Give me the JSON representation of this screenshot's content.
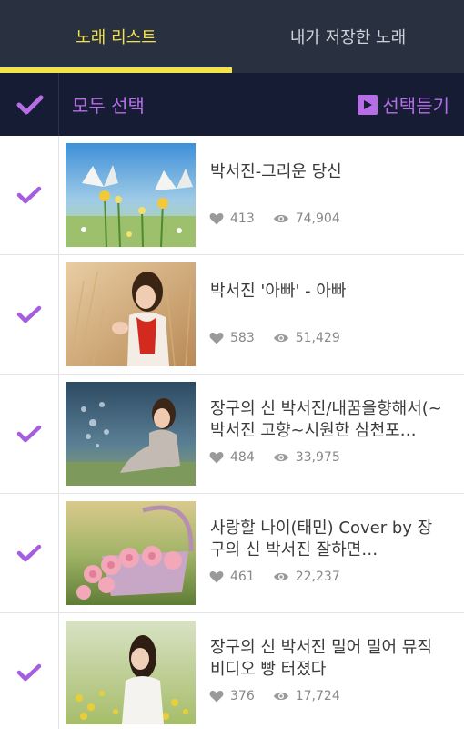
{
  "tabs": [
    {
      "label": "노래 리스트",
      "active": true
    },
    {
      "label": "내가 저장한 노래",
      "active": false
    }
  ],
  "select_bar": {
    "select_all_label": "모두 선택",
    "play_selected_label": "선택듣기"
  },
  "songs": [
    {
      "title": "박서진-그리운 당신",
      "likes": "413",
      "views": "74,904",
      "thumbnail": "butterflies-flowers"
    },
    {
      "title": "박서진 '아빠' - 아빠",
      "likes": "583",
      "views": "51,429",
      "thumbnail": "woman-wheat-field"
    },
    {
      "title": "장구의 신 박서진/내꿈을향해서(~박서진 고향~시원한 삼천포…",
      "likes": "484",
      "views": "33,975",
      "thumbnail": "woman-sitting-grass"
    },
    {
      "title": "사랑할 나이(태민) Cover by 장구의 신 박서진 잘하면…",
      "likes": "461",
      "views": "22,237",
      "thumbnail": "pink-roses-basket"
    },
    {
      "title": "장구의 신 박서진 밀어 밀어 뮤직 비디오 빵 터졌다",
      "likes": "376",
      "views": "17,724",
      "thumbnail": "woman-yellow-flowers"
    }
  ],
  "colors": {
    "tab_bg": "#293140",
    "tab_active": "#f3e24a",
    "select_bar_bg": "#171c35",
    "accent_purple": "#b66ee6",
    "check_purple": "#a65ee0"
  }
}
